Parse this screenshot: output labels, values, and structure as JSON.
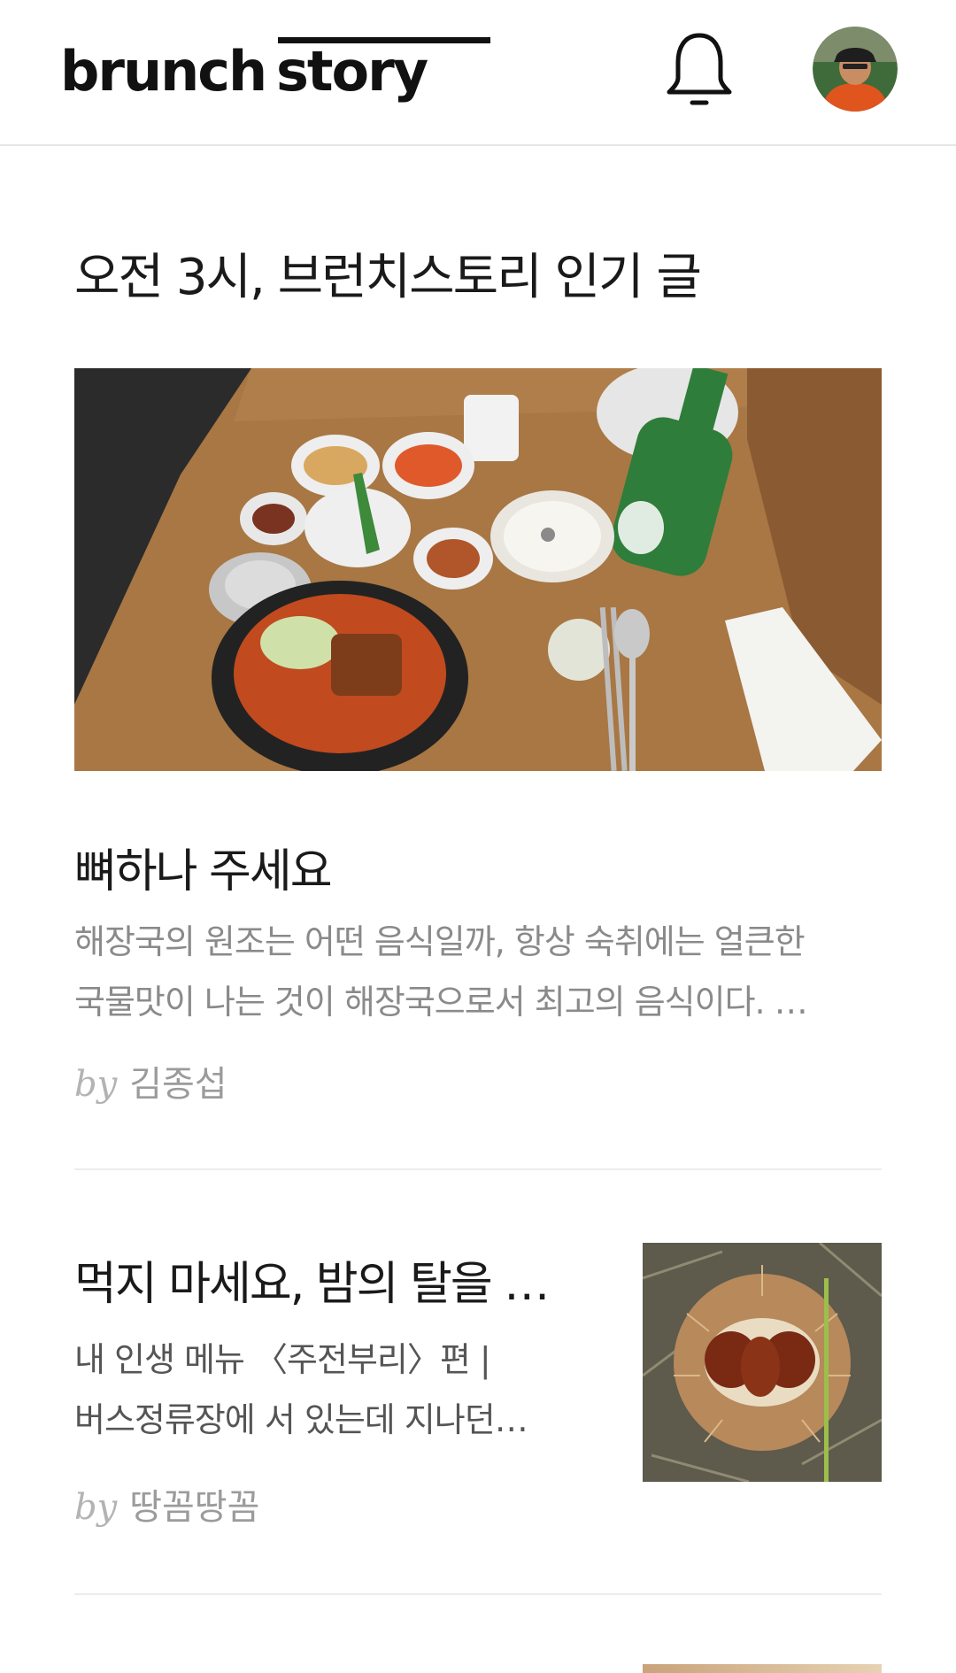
{
  "header": {
    "logo_word1": "brunch",
    "logo_word2": "story",
    "notification_icon": "bell-icon",
    "avatar_icon": "user-avatar"
  },
  "section": {
    "title": "오전 3시, 브런치스토리 인기 글"
  },
  "posts": [
    {
      "title": "뼈하나 주세요",
      "excerpt_line1": "해장국의 원조는 어떤 음식일까, 항상 숙취에는 얼큰한",
      "excerpt_line2": "국물맛이 나는 것이 해장국으로서 최고의 음식이다. …",
      "by": "by",
      "author": "김종섭"
    },
    {
      "title": "먹지 마세요, 밤의 탈을 …",
      "excerpt_line1": "내 인생 메뉴 〈주전부리〉편 |",
      "excerpt_line2": " 버스정류장에 서 있는데 지나던…",
      "by": "by",
      "author": "땅꼼땅꼼"
    }
  ],
  "colors": {
    "text": "#1a1a1a",
    "muted": "#8a8a8a",
    "divider": "#ececec"
  }
}
